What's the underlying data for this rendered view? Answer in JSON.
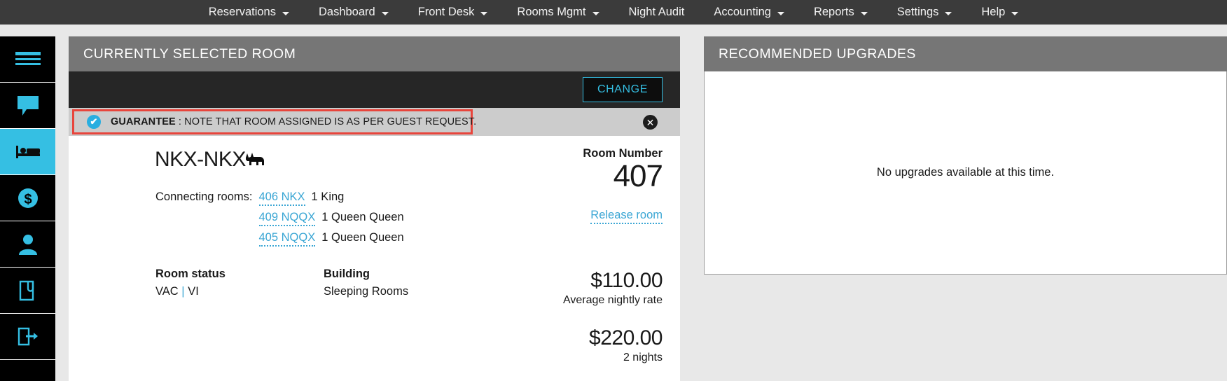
{
  "topnav": {
    "items": [
      {
        "label": "Reservations",
        "caret": true
      },
      {
        "label": "Dashboard",
        "caret": true
      },
      {
        "label": "Front Desk",
        "caret": true
      },
      {
        "label": "Rooms Mgmt",
        "caret": true
      },
      {
        "label": "Night Audit",
        "caret": false
      },
      {
        "label": "Accounting",
        "caret": true
      },
      {
        "label": "Reports",
        "caret": true
      },
      {
        "label": "Settings",
        "caret": true
      },
      {
        "label": "Help",
        "caret": true
      }
    ]
  },
  "rail": {
    "items": [
      {
        "icon": "hamburger-menu-icon",
        "active": false
      },
      {
        "icon": "chat-bubble-icon",
        "active": false
      },
      {
        "icon": "bed-icon",
        "active": true
      },
      {
        "icon": "dollar-circle-icon",
        "active": false
      },
      {
        "icon": "person-icon",
        "active": false
      },
      {
        "icon": "document-attachment-icon",
        "active": false
      },
      {
        "icon": "document-export-icon",
        "active": false
      }
    ]
  },
  "selected_room": {
    "panel_title": "CURRENTLY SELECTED ROOM",
    "change_button": "CHANGE",
    "guarantee": {
      "label": "GUARANTEE",
      "separator": " : ",
      "message": "NOTE THAT ROOM ASSIGNED IS AS PER GUEST REQUEST.",
      "check_glyph": "✔",
      "close_glyph": "✕",
      "border_color": "#e8453c"
    },
    "room_code": "NKX-NKX",
    "connecting_label": "Connecting rooms:",
    "connecting_rooms": [
      {
        "room": "406 NKX",
        "type": "1 King"
      },
      {
        "room": "409 NQQX",
        "type": "1 Queen Queen"
      },
      {
        "room": "405 NQQX",
        "type": "1 Queen Queen"
      }
    ],
    "room_status_head": "Room status",
    "room_status_value_a": "VAC",
    "room_status_sep": "|",
    "room_status_value_b": "VI",
    "building_head": "Building",
    "building_value": "Sleeping Rooms",
    "room_number_label": "Room Number",
    "room_number_value": "407",
    "release_link": "Release room",
    "rate_amount": "$110.00",
    "rate_caption": "Average nightly rate",
    "total_amount": "$220.00",
    "total_caption": "2 nights"
  },
  "upgrades": {
    "panel_title": "RECOMMENDED UPGRADES",
    "empty_message": "No upgrades available at this time."
  },
  "colors": {
    "accent": "#35bfe3",
    "link": "#3aa6d4",
    "nav_bg": "#3b3b3b",
    "header_bg": "#767676",
    "alert_border": "#e8453c"
  }
}
